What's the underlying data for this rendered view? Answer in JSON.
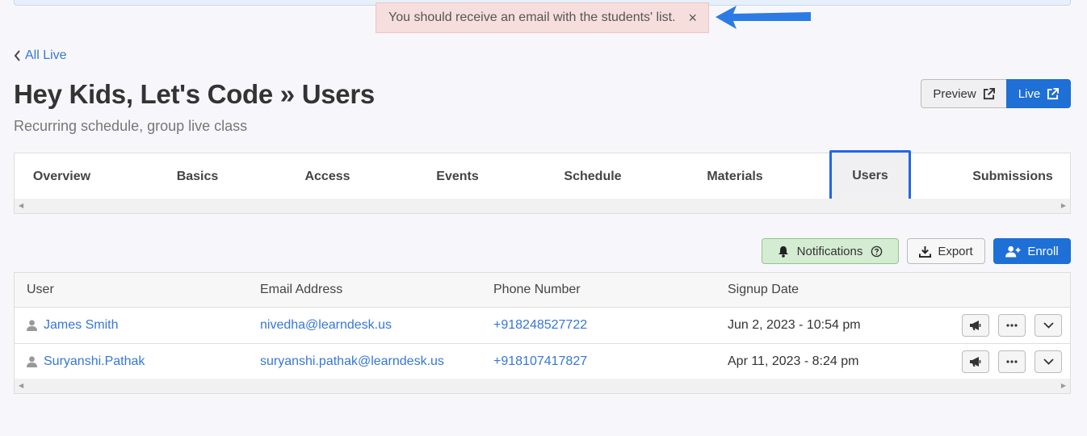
{
  "toast": {
    "message": "You should receive an email with the students' list.",
    "close": "×"
  },
  "nav": {
    "back_label": "All Live"
  },
  "header": {
    "title": "Hey Kids, Let's Code » Users",
    "subtitle": "Recurring schedule, group live class",
    "preview_label": "Preview",
    "live_label": "Live"
  },
  "tabs": [
    {
      "label": "Overview"
    },
    {
      "label": "Basics"
    },
    {
      "label": "Access"
    },
    {
      "label": "Events"
    },
    {
      "label": "Schedule"
    },
    {
      "label": "Materials"
    },
    {
      "label": "Users",
      "active": true
    },
    {
      "label": "Submissions"
    }
  ],
  "actions": {
    "notifications_label": "Notifications",
    "export_label": "Export",
    "enroll_label": "Enroll"
  },
  "table": {
    "columns": [
      "User",
      "Email Address",
      "Phone Number",
      "Signup Date"
    ],
    "rows": [
      {
        "user": "James Smith",
        "email": "nivedha@learndesk.us",
        "phone": "+918248527722",
        "signup": "Jun 2, 2023 - 10:54 pm"
      },
      {
        "user": "Suryanshi.Pathak",
        "email": "suryanshi.pathak@learndesk.us",
        "phone": "+918107417827",
        "signup": "Apr 11, 2023 - 8:24 pm"
      }
    ]
  },
  "colors": {
    "accent": "#1e6fd6",
    "link": "#3576d8",
    "active_tab_border": "#2266e8",
    "toast_bg": "#f6dedd",
    "notif_bg": "#d4ecd2"
  }
}
